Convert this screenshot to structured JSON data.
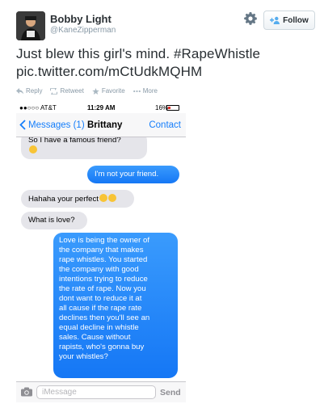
{
  "tweet": {
    "author_name": "Bobby Light",
    "author_handle": "@KaneZipperman",
    "follow_label": "Follow",
    "text_lines": [
      "Just blew this girl's mind. #RapeWhistle",
      "pic.twitter.com/mCtUdkMQHM"
    ],
    "actions": {
      "reply": "Reply",
      "retweet": "Retweet",
      "favorite": "Favorite",
      "more": "More"
    },
    "colors": {
      "text": "#292f33",
      "muted": "#8899a6",
      "follow_icon": "#55acee"
    },
    "icons": [
      "gear-icon",
      "follow-person-icon",
      "reply-icon",
      "retweet-icon",
      "star-icon",
      "more-dots-icon"
    ]
  },
  "phone": {
    "status": {
      "carrier": "●●○○○ AT&T",
      "time": "11:29 AM",
      "battery": "16%"
    },
    "nav": {
      "back_label": "Messages (1)",
      "title": "Brittany",
      "contact_label": "Contact"
    },
    "messages": [
      {
        "from": "them",
        "lines": [
          "So I have a famous friend?"
        ],
        "emoji_line": true
      },
      {
        "from": "me",
        "lines": [
          "I'm not your friend."
        ]
      },
      {
        "from": "them",
        "lines": [
          "Hahaha your perfect"
        ],
        "emoji_suffix": 2
      },
      {
        "from": "them",
        "lines": [
          "What is love?"
        ]
      },
      {
        "from": "me",
        "lines": [
          "Love is being the owner of",
          "the company that makes",
          "rape whistles. You started",
          "the company with good",
          "intentions trying to reduce",
          "the rate of rape. Now you",
          "dont want to reduce it at",
          "all cause if the rape rate",
          "declines then you'll see an",
          "equal decline in whistle",
          "sales. Cause without",
          "rapists, who's gonna buy",
          "your whistles?"
        ]
      }
    ],
    "input": {
      "placeholder": "iMessage",
      "value": "",
      "send_label": "Send"
    },
    "colors": {
      "ios_blue": "#157efb",
      "bubble_in": "#e5e5ea",
      "bubble_out": "#1d8bfd"
    }
  }
}
